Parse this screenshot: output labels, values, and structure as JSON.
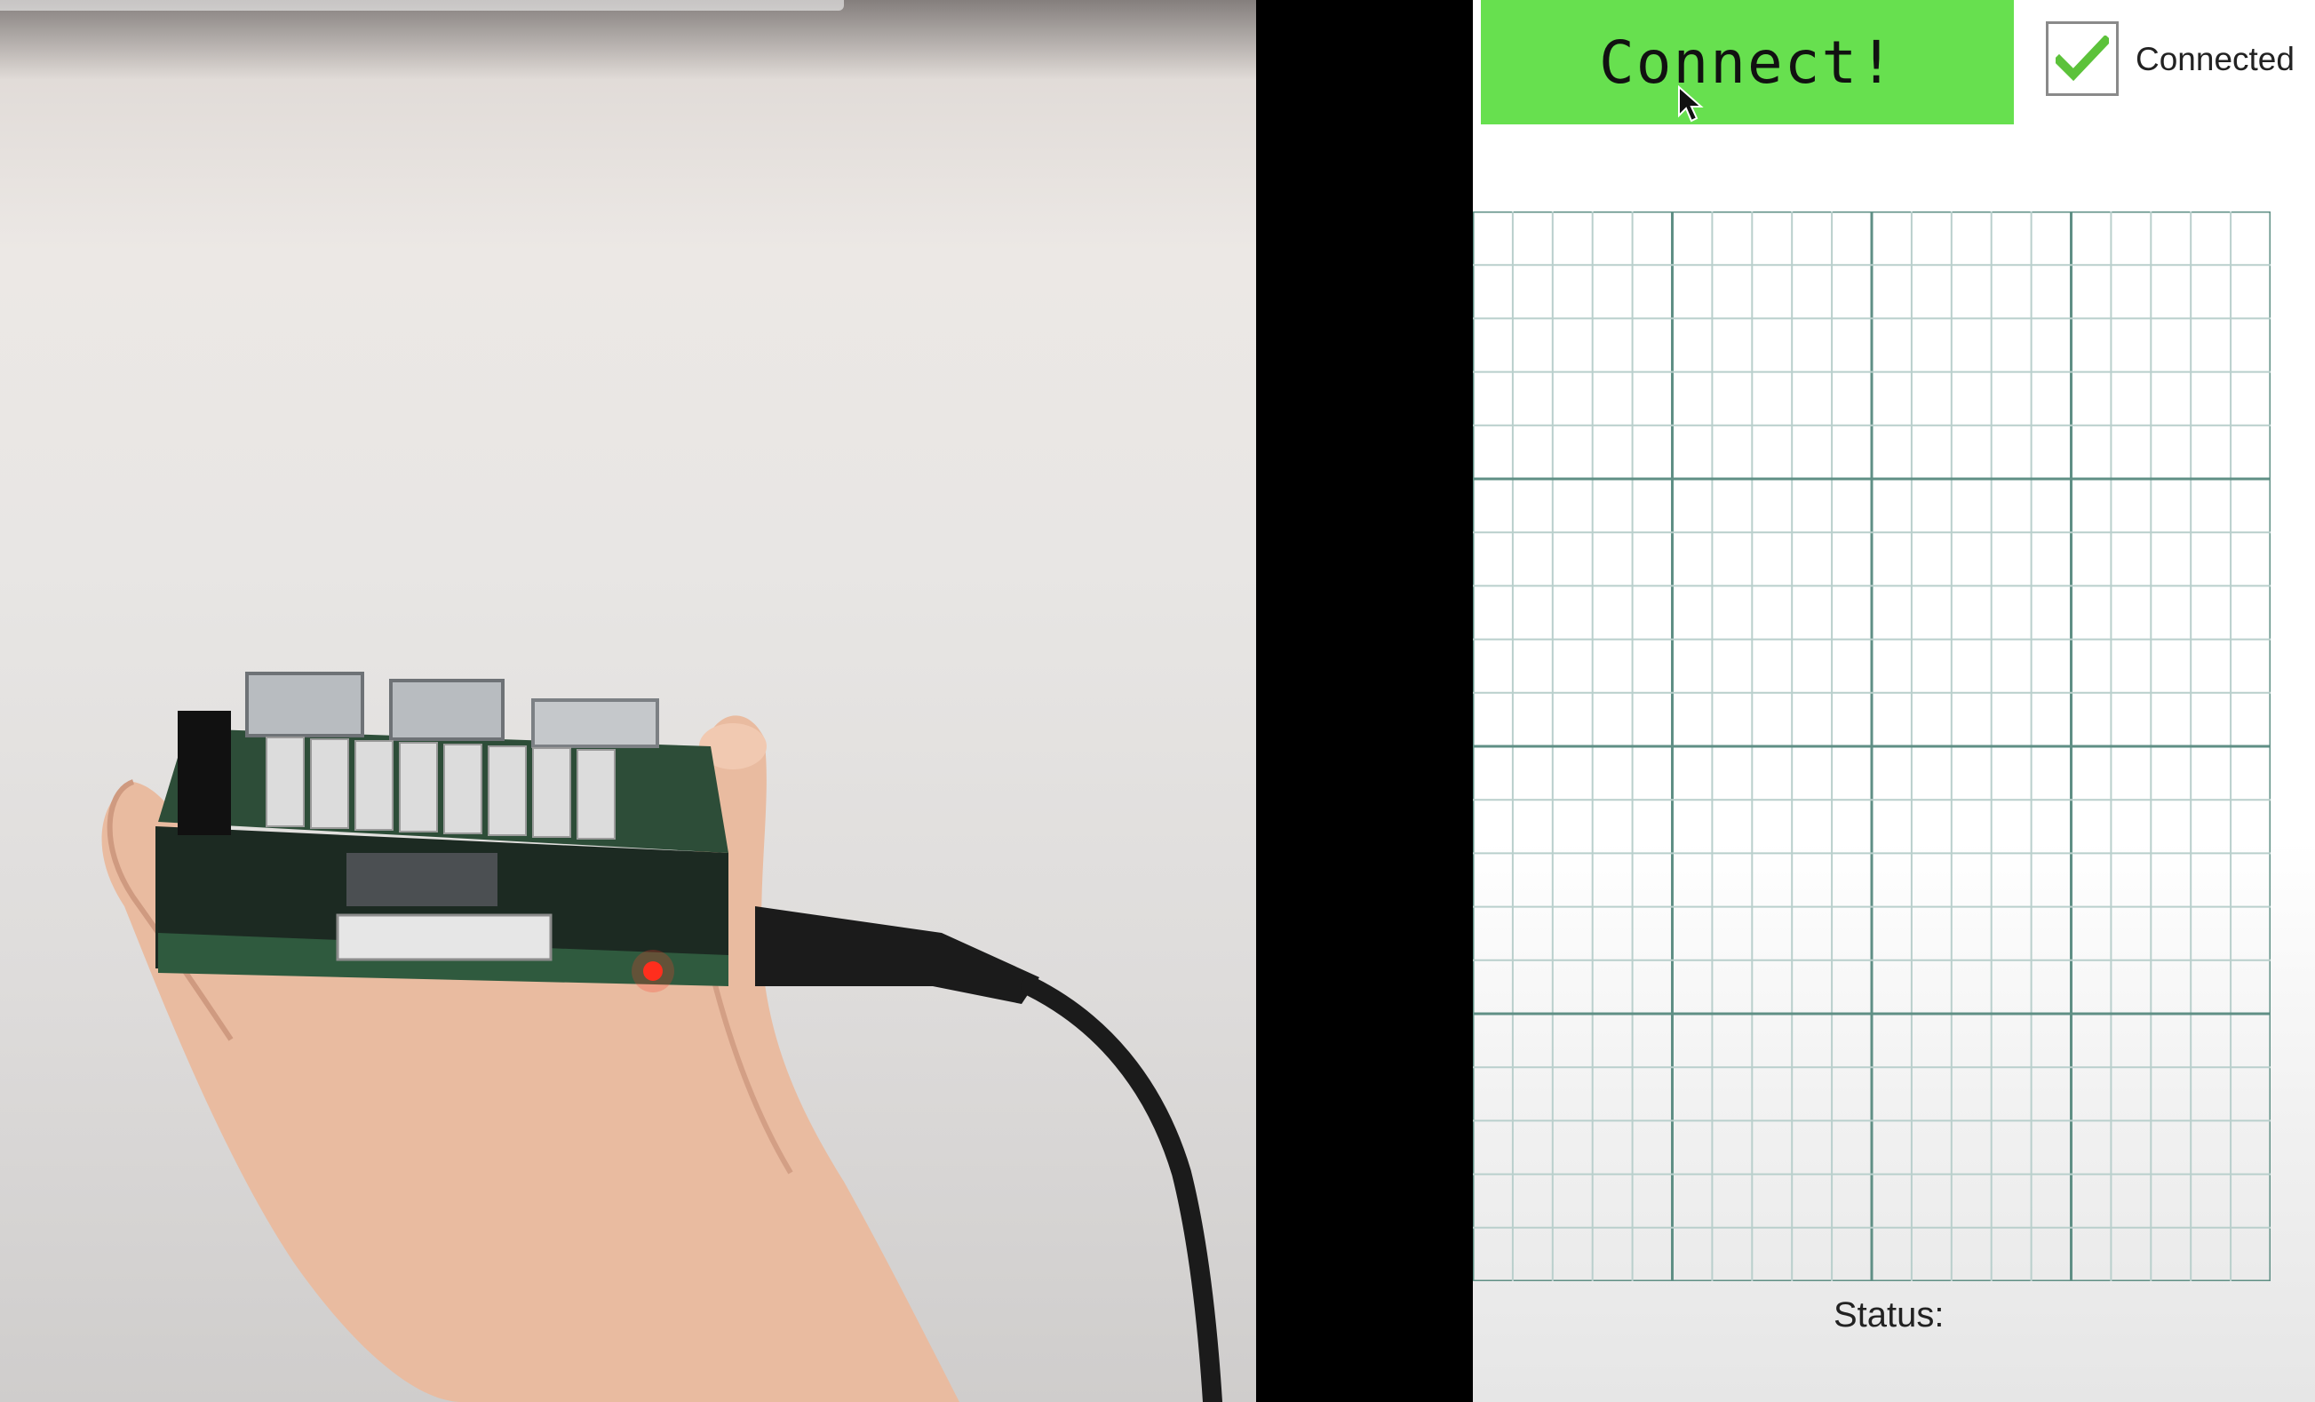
{
  "app": {
    "connect_button_label": "Connect!",
    "connected_checkbox": {
      "checked": true,
      "label": "Connected"
    },
    "status_label": "Status:"
  },
  "grid": {
    "minor_columns": 20,
    "minor_rows": 20,
    "major_every_columns": 5,
    "major_every_rows": 5
  },
  "colors": {
    "connect_button": "#67e04f",
    "checkmark": "#5cc23a",
    "grid_minor": "#b9cfcc",
    "grid_major": "#5f8f85"
  }
}
